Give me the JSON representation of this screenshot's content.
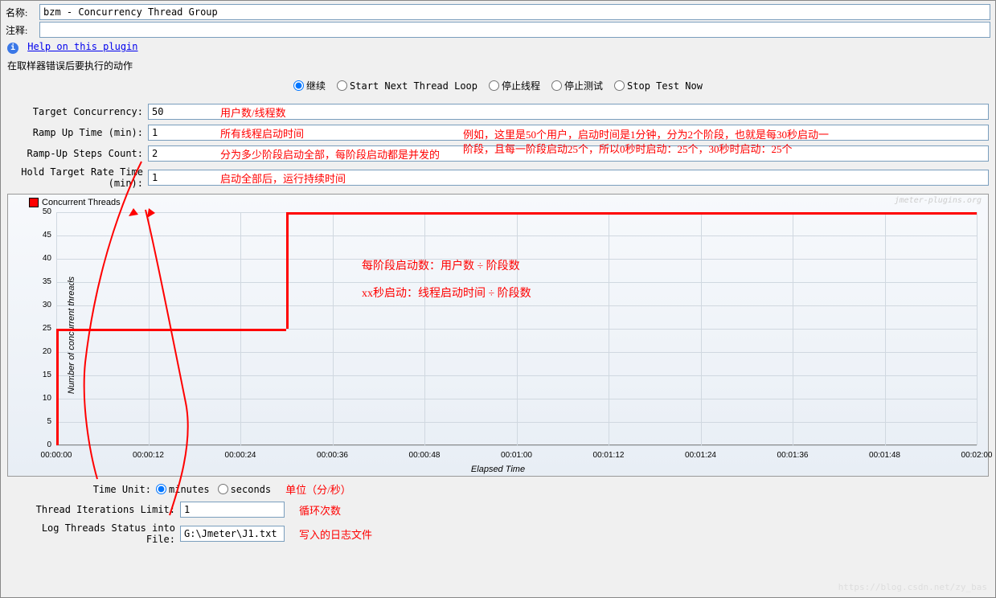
{
  "header": {
    "name_label": "名称:",
    "name_value": "bzm - Concurrency Thread Group",
    "comment_label": "注释:",
    "comment_value": "",
    "help_link": "Help on this plugin"
  },
  "error_section": {
    "title": "在取样器错误后要执行的动作",
    "options": [
      "继续",
      "Start Next Thread Loop",
      "停止线程",
      "停止测试",
      "Stop Test Now"
    ],
    "selected": 0
  },
  "fields": {
    "target_concurrency": {
      "label": "Target Concurrency:",
      "value": "50",
      "annot": "用户数/线程数"
    },
    "ramp_up_time": {
      "label": "Ramp Up Time (min):",
      "value": "1",
      "annot": "所有线程启动时间"
    },
    "ramp_up_steps": {
      "label": "Ramp-Up Steps Count:",
      "value": "2",
      "annot": "分为多少阶段启动全部，每阶段启动都是并发的"
    },
    "hold_time": {
      "label": "Hold Target Rate Time (min):",
      "value": "1",
      "annot": "启动全部后，运行持续时间"
    },
    "long_annot1": "例如，这里是50个用户，启动时间是1分钟，分为2个阶段，也就是每30秒启动一",
    "long_annot2": "阶段，且每一阶段启动25个，所以0秒时启动：25个，30秒时启动：25个"
  },
  "chart_data": {
    "type": "line",
    "title": "",
    "legend": "Concurrent Threads",
    "watermark": "jmeter-plugins.org",
    "xlabel": "Elapsed Time",
    "ylabel": "Number of concurrent threads",
    "ylim": [
      0,
      50
    ],
    "xlim_sec": [
      0,
      120
    ],
    "yticks": [
      0,
      5,
      10,
      15,
      20,
      25,
      30,
      35,
      40,
      45,
      50
    ],
    "xticks": [
      "00:00:00",
      "00:00:12",
      "00:00:24",
      "00:00:36",
      "00:00:48",
      "00:01:00",
      "00:01:12",
      "00:01:24",
      "00:01:36",
      "00:01:48",
      "00:02:00"
    ],
    "series": [
      {
        "name": "Concurrent Threads",
        "x_sec": [
          0,
          0,
          30,
          30,
          120
        ],
        "y": [
          0,
          25,
          25,
          50,
          50
        ]
      }
    ],
    "annot1": "每阶段启动数：用户数 ÷ 阶段数",
    "annot2": "xx秒启动：线程启动时间 ÷ 阶段数"
  },
  "bottom": {
    "time_unit": {
      "label": "Time Unit:",
      "minutes": "minutes",
      "seconds": "seconds",
      "selected": "minutes",
      "annot": "单位（分/秒）"
    },
    "iterations": {
      "label": "Thread Iterations Limit:",
      "value": "1",
      "annot": "循环次数"
    },
    "log_file": {
      "label": "Log Threads Status into File:",
      "value": "G:\\Jmeter\\J1.txt",
      "annot": "写入的日志文件"
    }
  },
  "page_wm": "https://blog.csdn.net/zy_bas"
}
